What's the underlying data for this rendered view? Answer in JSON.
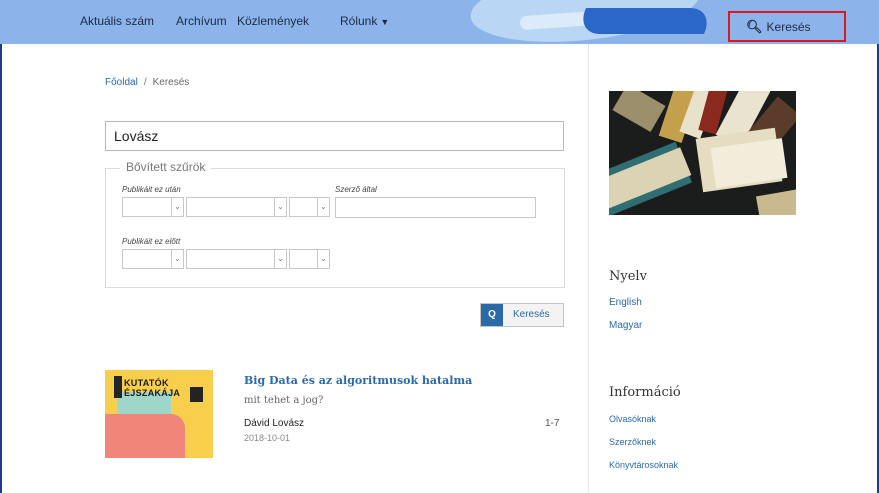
{
  "nav": {
    "items": [
      "Aktuális szám",
      "Archívum",
      "Közlemények",
      "Rólunk"
    ],
    "search_label": "Keresés"
  },
  "breadcrumb": {
    "home": "Főoldal",
    "separator": "/",
    "current": "Keresés"
  },
  "search": {
    "query": "Lovász",
    "advanced_legend": "Bővített szűrök",
    "published_after_label": "Publikáit ez után",
    "published_before_label": "Publikáit ez előtt",
    "author_label": "Szerző által",
    "button_label": "Keresés"
  },
  "result": {
    "thumb_line1": "KUTATÓK",
    "thumb_line2": "ÉJSZAKÁJA",
    "title": "Big Data és az algoritmusok hatalma",
    "subtitle": "mit tehet a jog?",
    "author": "Dávid Lovász",
    "pages": "1-7",
    "date": "2018-10-01"
  },
  "sidebar": {
    "language_heading": "Nyelv",
    "languages": [
      "English",
      "Magyar"
    ],
    "info_heading": "Információ",
    "info_links": [
      "Olvasóknak",
      "Szerzőknek",
      "Könyvtárosoknak"
    ]
  },
  "colors": {
    "nav_bg": "#8cb4ea",
    "accent": "#2b6aa8",
    "highlight_border": "#e0161f"
  },
  "icons": {
    "search": "magnifier",
    "dropdown": "chevron-down",
    "caret": "caret-down"
  }
}
